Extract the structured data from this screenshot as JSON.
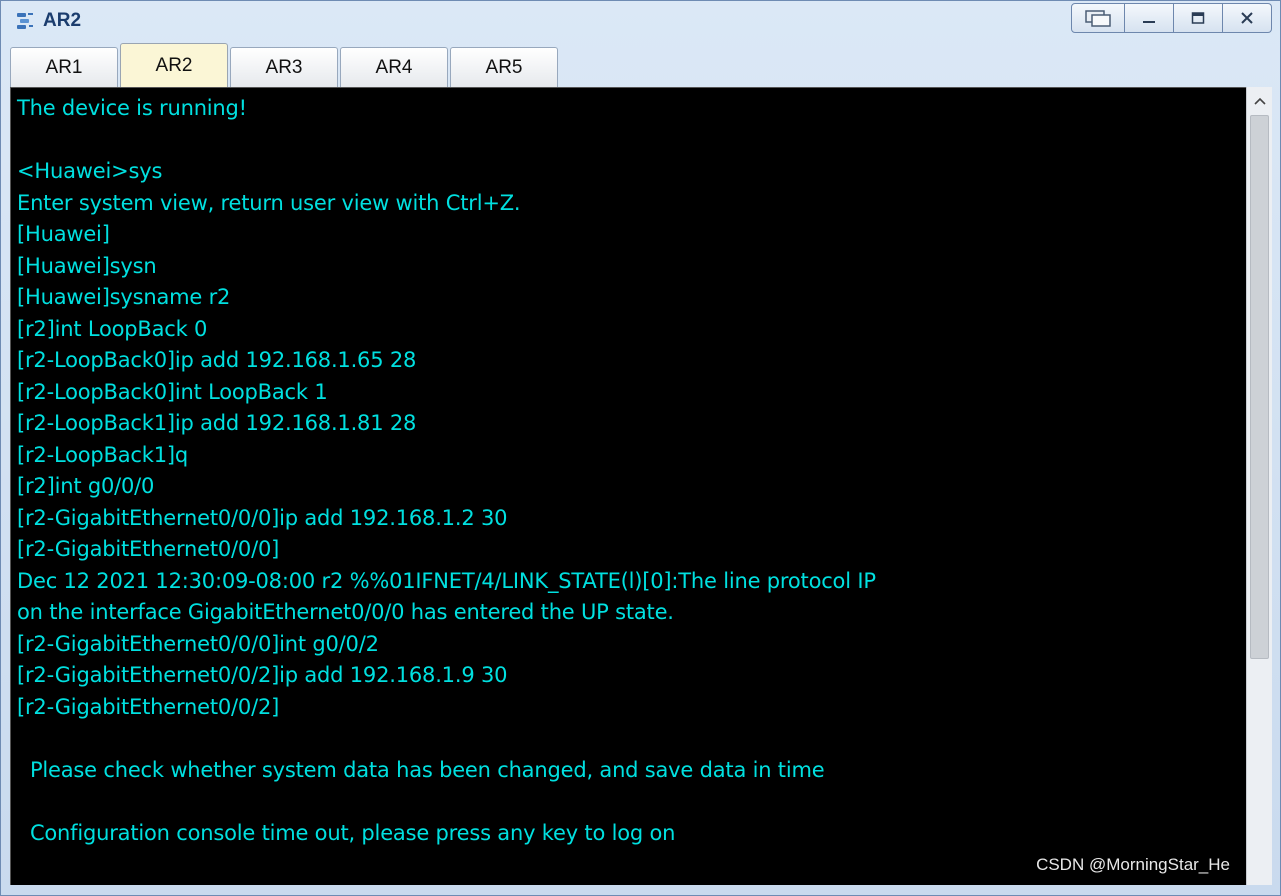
{
  "window": {
    "title": "AR2",
    "icon": "router-icon",
    "controls": [
      "restore-icon",
      "minimize-icon",
      "maximize-icon",
      "close-icon"
    ]
  },
  "tabs": [
    {
      "label": "AR1",
      "active": false
    },
    {
      "label": "AR2",
      "active": true
    },
    {
      "label": "AR3",
      "active": false
    },
    {
      "label": "AR4",
      "active": false
    },
    {
      "label": "AR5",
      "active": false
    }
  ],
  "terminal": {
    "text_color": "#00e0e0",
    "background": "#000000",
    "lines": [
      "The device is running!",
      "",
      "<Huawei>sys",
      "Enter system view, return user view with Ctrl+Z.",
      "[Huawei]",
      "[Huawei]sysn",
      "[Huawei]sysname r2",
      "[r2]int LoopBack 0",
      "[r2-LoopBack0]ip add 192.168.1.65 28",
      "[r2-LoopBack0]int LoopBack 1",
      "[r2-LoopBack1]ip add 192.168.1.81 28",
      "[r2-LoopBack1]q",
      "[r2]int g0/0/0",
      "[r2-GigabitEthernet0/0/0]ip add 192.168.1.2 30",
      "[r2-GigabitEthernet0/0/0]",
      "Dec 12 2021 12:30:09-08:00 r2 %%01IFNET/4/LINK_STATE(l)[0]:The line protocol IP",
      "on the interface GigabitEthernet0/0/0 has entered the UP state.",
      "[r2-GigabitEthernet0/0/0]int g0/0/2",
      "[r2-GigabitEthernet0/0/2]ip add 192.168.1.9 30",
      "[r2-GigabitEthernet0/0/2]",
      "",
      "  Please check whether system data has been changed, and save data in time",
      "",
      "  Configuration console time out, please press any key to log on"
    ]
  },
  "watermark": "CSDN @MorningStar_He"
}
